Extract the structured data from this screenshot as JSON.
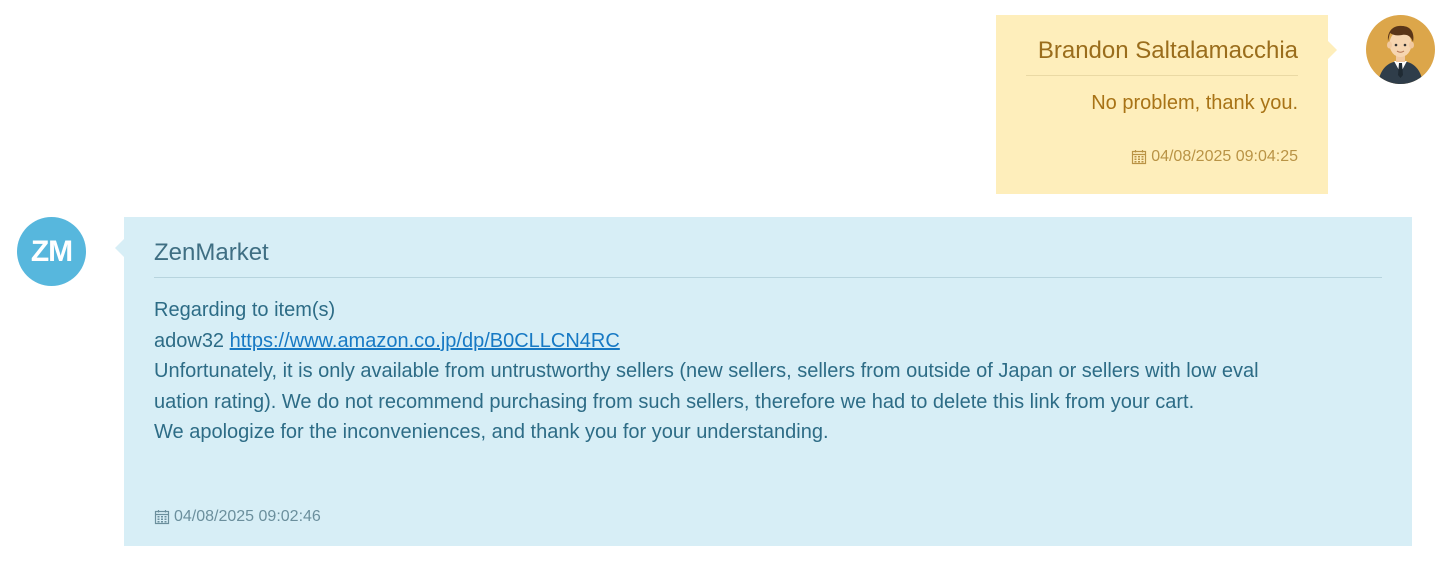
{
  "messages": [
    {
      "sender": "Brandon Saltalamacchia",
      "text": "No problem, thank you.",
      "timestamp": "04/08/2025 09:04:25",
      "avatar_icon": "user-avatar-icon",
      "bubble_color": "#feeebb"
    },
    {
      "sender": "ZenMarket",
      "avatar_text": "ZM",
      "lines": {
        "line1": "Regarding to item(s)",
        "item_prefix": "adow32",
        "item_link": "https://www.amazon.co.jp/dp/B0CLLCN4RC",
        "line3": "Unfortunately, it is only available from untrustworthy sellers (new sellers, sellers from outside of Japan or sellers with low eval",
        "line4": "uation rating). We do not recommend purchasing from such sellers, therefore we had to delete this link from your cart.",
        "line5": "We apologize for the inconveniences, and thank you for your understanding."
      },
      "timestamp": "04/08/2025 09:02:46",
      "bubble_color": "#d7eef6",
      "avatar_color": "#57b7dd"
    }
  ],
  "icons": {
    "timestamp_icon": "calendar-icon"
  }
}
